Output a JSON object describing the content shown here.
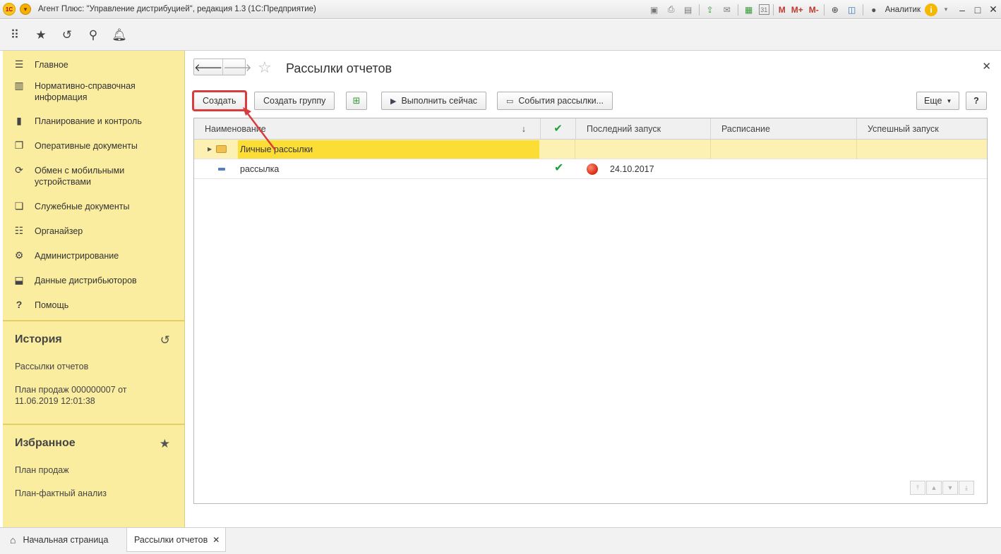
{
  "window": {
    "title": "Агент Плюс: \"Управление дистрибуцией\", редакция 1.3  (1С:Предприятие)",
    "logo": "1С",
    "user": "Аналитик",
    "m_buttons": [
      "M",
      "M+",
      "M-"
    ],
    "calendar_day": "31"
  },
  "sidebar": {
    "items": [
      {
        "icon": "menu-icon",
        "label": "Главное"
      },
      {
        "icon": "reference-icon",
        "label": "Нормативно-справочная информация"
      },
      {
        "icon": "chart-icon",
        "label": "Планирование и контроль"
      },
      {
        "icon": "documents-icon",
        "label": "Оперативные документы"
      },
      {
        "icon": "sync-icon",
        "label": "Обмен с мобильными устройствами"
      },
      {
        "icon": "service-docs-icon",
        "label": "Служебные документы"
      },
      {
        "icon": "organizer-icon",
        "label": "Органайзер"
      },
      {
        "icon": "gear-icon",
        "label": "Администрирование"
      },
      {
        "icon": "distributor-icon",
        "label": "Данные дистрибьюторов"
      },
      {
        "icon": "help-icon",
        "label": "Помощь"
      }
    ]
  },
  "history": {
    "title": "История",
    "items": [
      "Рассылки отчетов",
      "План продаж 000000007 от 11.06.2019 12:01:38"
    ]
  },
  "favorites": {
    "title": "Избранное",
    "items": [
      "План продаж",
      "План-фактный анализ"
    ]
  },
  "content": {
    "title": "Рассылки отчетов",
    "buttons": {
      "create": "Создать",
      "create_group": "Создать группу",
      "run_now": "Выполнить сейчас",
      "events": "События рассылки...",
      "more": "Еще",
      "help": "?"
    },
    "columns": [
      "Наименование",
      "Последний запуск",
      "Расписание",
      "Успешный запуск"
    ],
    "rows": [
      {
        "name": "Личные рассылки",
        "type": "group",
        "enabled": false,
        "last_run": "",
        "schedule": "",
        "success_run": ""
      },
      {
        "name": "рассылка",
        "type": "item",
        "enabled": true,
        "last_run": "24.10.2017",
        "schedule": "",
        "success_run": ""
      }
    ]
  },
  "tabs": {
    "home": "Начальная страница",
    "active": "Рассылки отчетов"
  },
  "colors": {
    "sidebar_bg": "#fbeda0",
    "selection": "#fbdd36",
    "highlight_red": "#d93c3c",
    "check_green": "#1aa23a"
  }
}
